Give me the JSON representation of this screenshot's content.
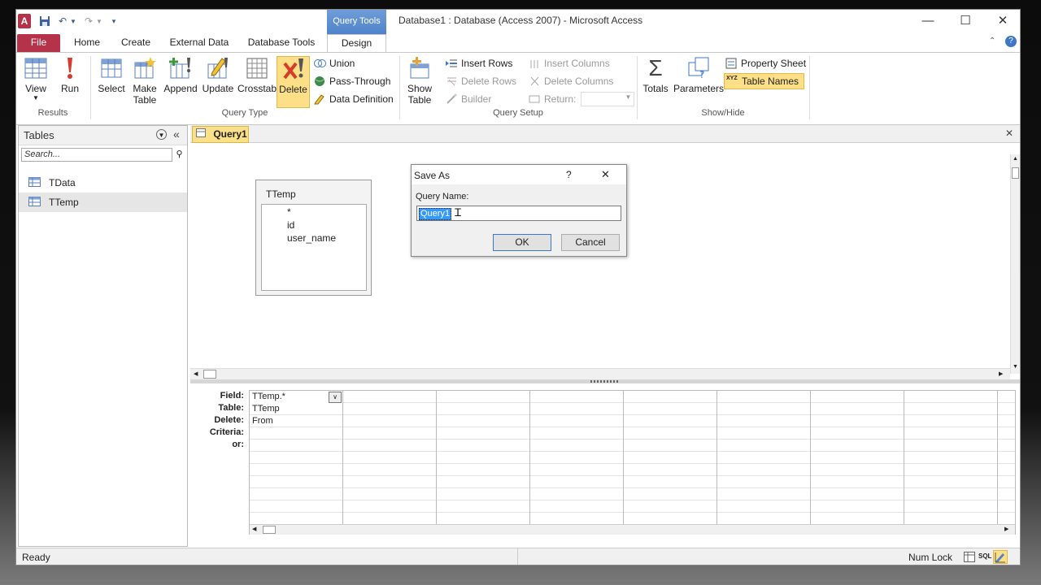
{
  "window": {
    "title": "Database1 : Database (Access 2007)  -  Microsoft Access",
    "context_tab": "Query Tools",
    "app_letter": "A"
  },
  "ribbon_tabs": [
    "File",
    "Home",
    "Create",
    "External Data",
    "Database Tools",
    "Design"
  ],
  "ribbon": {
    "results": {
      "label": "Results",
      "view": "View",
      "run": "Run"
    },
    "query_type": {
      "label": "Query Type",
      "select": "Select",
      "make_table_1": "Make",
      "make_table_2": "Table",
      "append": "Append",
      "update": "Update",
      "crosstab": "Crosstab",
      "delete": "Delete",
      "union": "Union",
      "pass_through": "Pass-Through",
      "data_definition": "Data Definition"
    },
    "query_setup": {
      "label": "Query Setup",
      "show_table_1": "Show",
      "show_table_2": "Table",
      "insert_rows": "Insert Rows",
      "delete_rows": "Delete Rows",
      "builder": "Builder",
      "insert_columns": "Insert Columns",
      "delete_columns": "Delete Columns",
      "return": "Return:"
    },
    "show_hide": {
      "label": "Show/Hide",
      "totals": "Totals",
      "parameters": "Parameters",
      "property_sheet": "Property Sheet",
      "table_names": "Table Names",
      "xyz": "XYZ"
    }
  },
  "nav": {
    "title": "Tables",
    "search_placeholder": "Search...",
    "items": [
      "TData",
      "TTemp"
    ]
  },
  "document": {
    "tab": "Query1",
    "table_box": {
      "title": "TTemp",
      "fields": [
        "*",
        "id",
        "user_name"
      ]
    }
  },
  "grid": {
    "row_labels": [
      "Field:",
      "Table:",
      "Delete:",
      "Criteria:",
      "or:"
    ],
    "col1": {
      "field": "TTemp.*",
      "table": "TTemp",
      "delete": "From"
    }
  },
  "dialog": {
    "title": "Save As",
    "help": "?",
    "label": "Query Name:",
    "value": "Query1",
    "ok": "OK",
    "cancel": "Cancel"
  },
  "status": {
    "left": "Ready",
    "num_lock": "Num Lock",
    "sql": "SQL"
  },
  "colors": {
    "file_tab": "#b5334a",
    "accent_blue": "#4f83c9",
    "highlight": "#fbe08a",
    "selection": "#3399ff"
  }
}
